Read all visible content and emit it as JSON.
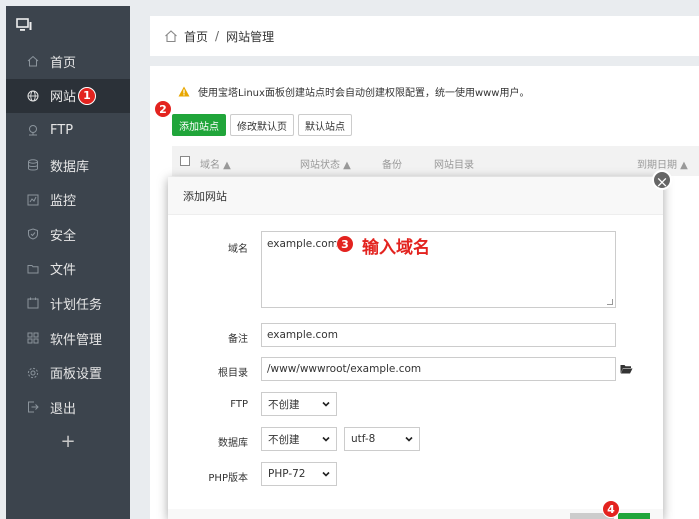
{
  "sidebar": {
    "items": [
      {
        "label": "首页",
        "icon": "home-icon"
      },
      {
        "label": "网站",
        "icon": "globe-icon"
      },
      {
        "label": "FTP",
        "icon": "ftp-icon"
      },
      {
        "label": "数据库",
        "icon": "database-icon"
      },
      {
        "label": "监控",
        "icon": "monitor-icon"
      },
      {
        "label": "安全",
        "icon": "shield-icon"
      },
      {
        "label": "文件",
        "icon": "folder-icon"
      },
      {
        "label": "计划任务",
        "icon": "calendar-icon"
      },
      {
        "label": "软件管理",
        "icon": "apps-icon"
      },
      {
        "label": "面板设置",
        "icon": "gear-icon"
      },
      {
        "label": "退出",
        "icon": "logout-icon"
      }
    ],
    "add_label": "+"
  },
  "breadcrumb": {
    "home": "首页",
    "separator": "/",
    "current": "网站管理"
  },
  "warning": "使用宝塔Linux面板创建站点时会自动创建权限配置，统一使用www用户。",
  "toolbar": {
    "add_site": "添加站点",
    "modify_default": "修改默认页",
    "default_site": "默认站点"
  },
  "table": {
    "headers": [
      "域名 ▲",
      "网站状态 ▲",
      "备份",
      "网站目录",
      "到期日期 ▲"
    ]
  },
  "modal": {
    "title": "添加网站",
    "close": "×",
    "domain_label": "域名",
    "domain_value": "example.com",
    "remark_label": "备注",
    "remark_value": "example.com",
    "root_label": "根目录",
    "root_value": "/www/wwwroot/example.com",
    "ftp_label": "FTP",
    "ftp_value": "不创建",
    "db_label": "数据库",
    "db_value": "不创建",
    "charset_value": "utf-8",
    "php_label": "PHP版本",
    "php_value": "PHP-72"
  },
  "annotations": {
    "n1": "1",
    "n2": "2",
    "n3": "3",
    "n3_text": "输入域名",
    "n4": "4"
  },
  "colors": {
    "sidebar": "#3c444d",
    "accent": "#20a53a",
    "badge": "#e3231f"
  }
}
